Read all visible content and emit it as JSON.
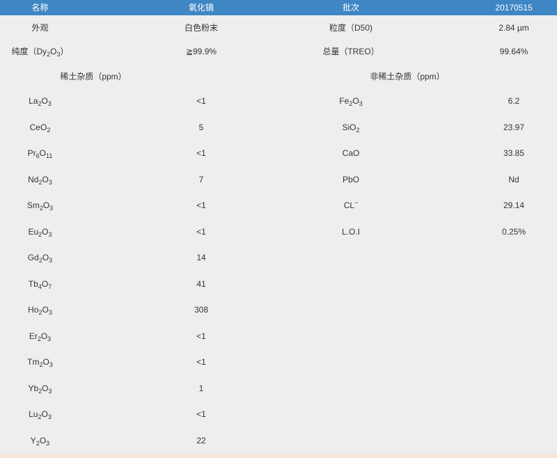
{
  "header": {
    "name_label": "名称",
    "name_value": "氧化镝",
    "batch_label": "批次",
    "batch_value": "20170515"
  },
  "properties": {
    "appearance_label": "外观",
    "appearance_value": "白色粉末",
    "particle_label": "粒度（D50)",
    "particle_value": "2.84 µm",
    "purity_label_prefix": "纯度（Dy",
    "purity_label_sub1": "2",
    "purity_label_mid": "O",
    "purity_label_sub2": "3",
    "purity_label_suffix": "）",
    "purity_value": "≧99.9%",
    "treo_label": "总量（TREO）",
    "treo_value": "99.64%"
  },
  "sections": {
    "re_title": "稀土杂质（ppm）",
    "non_re_title": "非稀土杂质（ppm）"
  },
  "re_impurities": [
    {
      "a": "La",
      "s1": "2",
      "b": "O",
      "s2": "3",
      "value": "<1"
    },
    {
      "a": "CeO",
      "s1": "2",
      "b": "",
      "s2": "",
      "value": "5"
    },
    {
      "a": "Pr",
      "s1": "6",
      "b": "O",
      "s2": "11",
      "value": "<1"
    },
    {
      "a": "Nd",
      "s1": "2",
      "b": "O",
      "s2": "3",
      "value": "7"
    },
    {
      "a": "Sm",
      "s1": "2",
      "b": "O",
      "s2": "3",
      "value": "<1"
    },
    {
      "a": "Eu",
      "s1": "2",
      "b": "O",
      "s2": "3",
      "value": "<1"
    },
    {
      "a": "Gd",
      "s1": "2",
      "b": "O",
      "s2": "3",
      "value": "14"
    },
    {
      "a": "Tb",
      "s1": "4",
      "b": "O",
      "s2": "7",
      "value": "41"
    },
    {
      "a": "Ho",
      "s1": "2",
      "b": "O",
      "s2": "3",
      "value": "308"
    },
    {
      "a": "Er",
      "s1": "2",
      "b": "O",
      "s2": "3",
      "value": "<1"
    },
    {
      "a": "Tm",
      "s1": "2",
      "b": "O",
      "s2": "3",
      "value": "<1"
    },
    {
      "a": "Yb",
      "s1": "2",
      "b": "O",
      "s2": "3",
      "value": "1"
    },
    {
      "a": "Lu",
      "s1": "2",
      "b": "O",
      "s2": "3",
      "value": "<1"
    },
    {
      "a": "Y",
      "s1": "2",
      "b": "O",
      "s2": "3",
      "value": "22"
    }
  ],
  "non_re_impurities": [
    {
      "a": "Fe",
      "s1": "2",
      "b": "O",
      "s2": "3",
      "sup": "",
      "value": "6.2"
    },
    {
      "a": "SiO",
      "s1": "2",
      "b": "",
      "s2": "",
      "sup": "",
      "value": "23.97"
    },
    {
      "a": "CaO",
      "s1": "",
      "b": "",
      "s2": "",
      "sup": "",
      "value": "33.85"
    },
    {
      "a": "PbO",
      "s1": "",
      "b": "",
      "s2": "",
      "sup": "",
      "value": "Nd"
    },
    {
      "a": "CL",
      "s1": "",
      "b": "",
      "s2": "",
      "sup": "−",
      "value": "29.14"
    },
    {
      "a": "L.O.I",
      "s1": "",
      "b": "",
      "s2": "",
      "sup": "",
      "value": "0.25%"
    }
  ],
  "colors": {
    "header_bg": "#3e86c4",
    "page_bg": "#eeeeee"
  }
}
